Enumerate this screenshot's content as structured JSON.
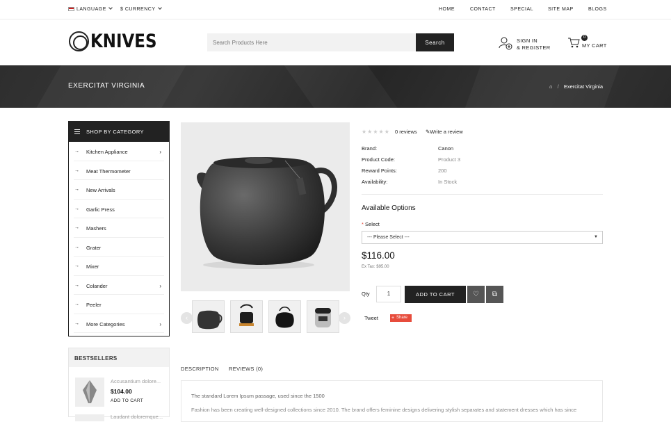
{
  "topbar": {
    "language": "Language",
    "currency": "$ Currency",
    "nav": [
      "Home",
      "Contact",
      "Special",
      "Site Map",
      "Blogs"
    ]
  },
  "header": {
    "logo": "KNIVES",
    "search_placeholder": "Search Products Here",
    "search_button": "Search",
    "account_line1": "Sign In",
    "account_line2": "& Register",
    "cart_count": "0",
    "cart_label": "My Cart"
  },
  "banner": {
    "title": "Exercitat Virginia",
    "breadcrumb_current": "Exercitat Virginia"
  },
  "sidebar": {
    "category_title": "Shop By Category",
    "categories": [
      {
        "label": "Kitchen Appliance",
        "has_sub": true
      },
      {
        "label": "Meat Thermometer",
        "has_sub": false
      },
      {
        "label": "New Arrivals",
        "has_sub": false
      },
      {
        "label": "Garlic Press",
        "has_sub": false
      },
      {
        "label": "Mashers",
        "has_sub": false
      },
      {
        "label": "Grater",
        "has_sub": false
      },
      {
        "label": "Mixer",
        "has_sub": false
      },
      {
        "label": "Colander",
        "has_sub": true
      },
      {
        "label": "Peeler",
        "has_sub": false
      },
      {
        "label": "More Categories",
        "has_sub": true
      }
    ],
    "bestsellers_title": "Bestsellers",
    "bestsellers": [
      {
        "name": "Accusantium dolore...",
        "price": "$104.00",
        "cta": "Add To Cart"
      },
      {
        "name": "Laudant doloremque...",
        "price": "",
        "cta": ""
      }
    ]
  },
  "product": {
    "reviews": "0 reviews",
    "write_review": "Write a review",
    "specs": [
      {
        "label": "Brand:",
        "value": "Canon"
      },
      {
        "label": "Product Code:",
        "value": "Product 3"
      },
      {
        "label": "Reward Points:",
        "value": "200"
      },
      {
        "label": "Availability:",
        "value": "In Stock"
      }
    ],
    "options_title": "Available Options",
    "select_label": "Select",
    "select_value": "--- Please Select ---",
    "price": "$116.00",
    "ex_tax": "Ex Tax: $95.00",
    "qty_label": "Qty",
    "qty_value": "1",
    "add_to_cart": "Add To Cart",
    "tweet": "Tweet",
    "share": "Share"
  },
  "tabs": {
    "description": "Description",
    "reviews": "Reviews (0)"
  },
  "description": {
    "line1": "The standard Lorem Ipsum passage, used since the 1500",
    "line2": "Fashion has been creating well-designed collections since 2010. The brand offers feminine designs delivering stylish separates and statement dresses which has since"
  },
  "colors": {
    "dark": "#222222",
    "banner": "#2e2e2e",
    "required": "#e74c3c"
  }
}
